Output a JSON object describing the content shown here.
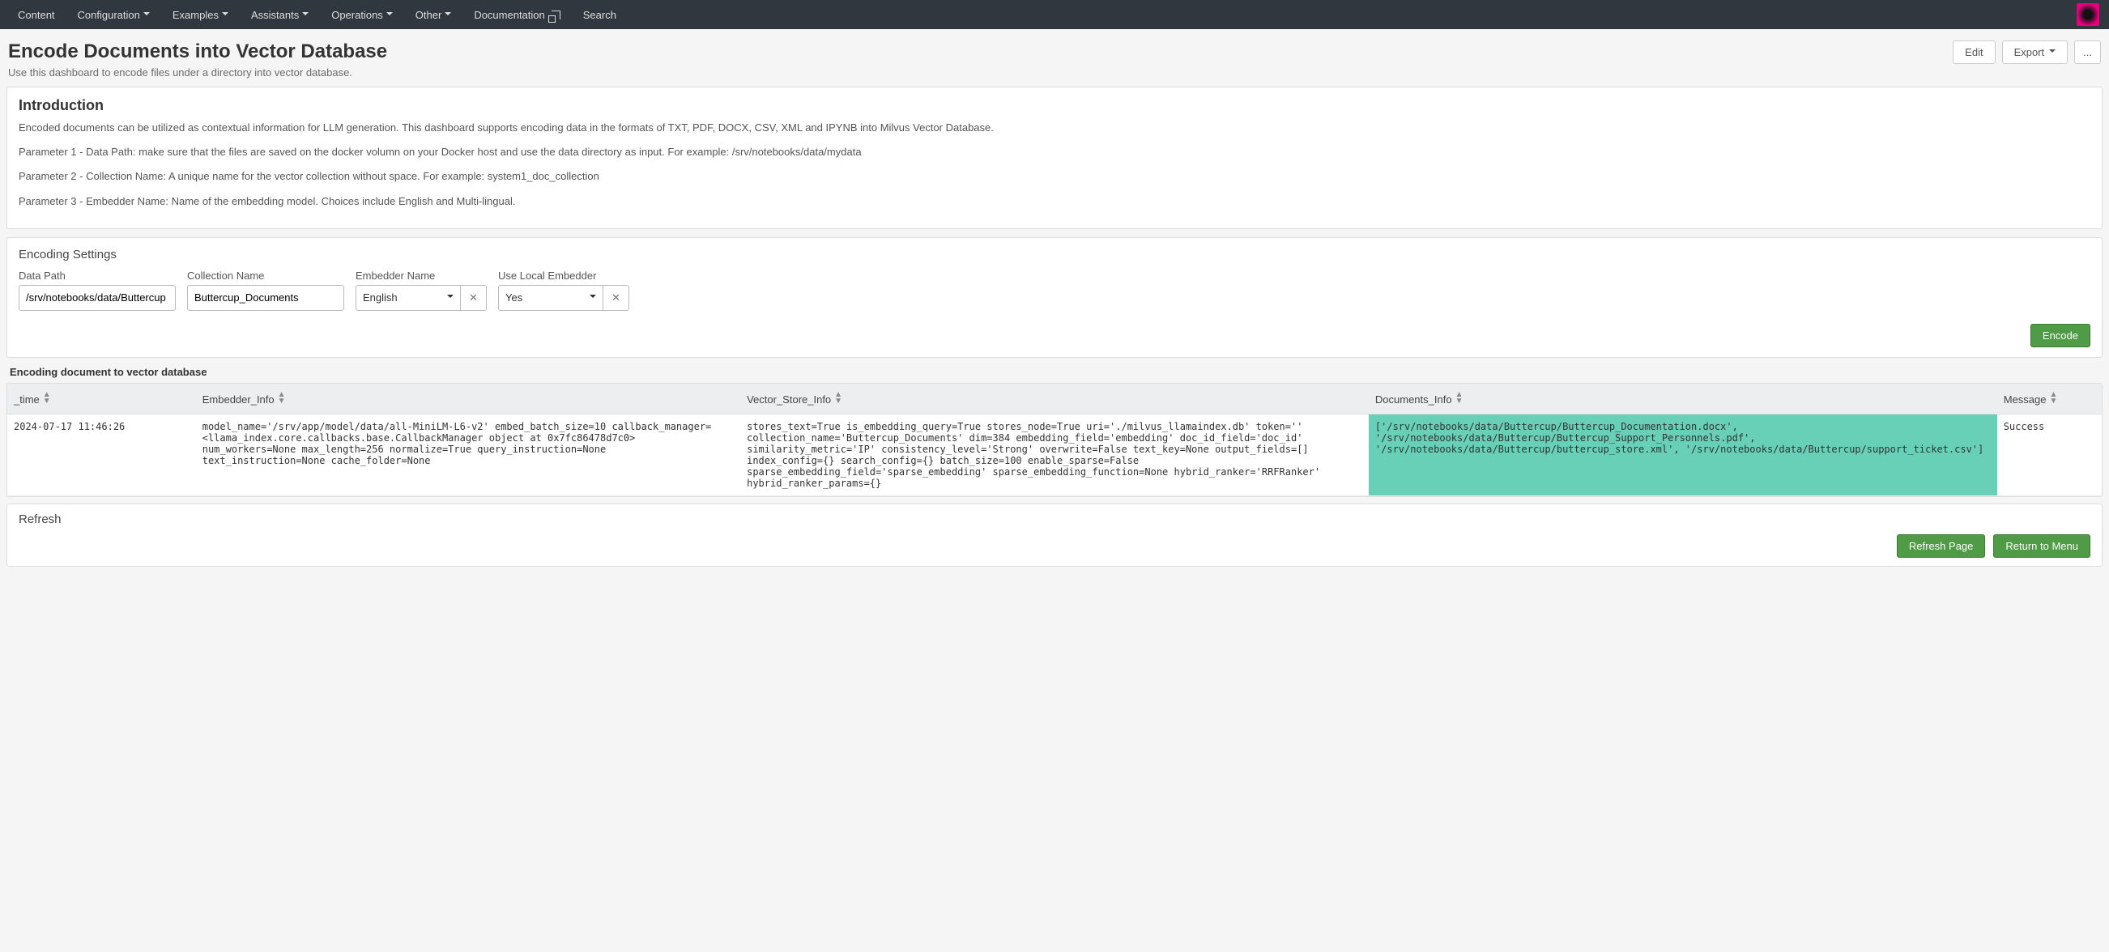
{
  "nav": {
    "items": [
      {
        "label": "Content",
        "caret": false
      },
      {
        "label": "Configuration",
        "caret": true
      },
      {
        "label": "Examples",
        "caret": true
      },
      {
        "label": "Assistants",
        "caret": true
      },
      {
        "label": "Operations",
        "caret": true
      },
      {
        "label": "Other",
        "caret": true
      },
      {
        "label": "Documentation",
        "external": true
      },
      {
        "label": "Search",
        "caret": false
      }
    ]
  },
  "header": {
    "title": "Encode Documents into Vector Database",
    "subtitle": "Use this dashboard to encode files under a directory into vector database.",
    "edit": "Edit",
    "export": "Export",
    "more": "..."
  },
  "intro": {
    "heading": "Introduction",
    "lines": [
      "Encoded documents can be utilized as contextual information for LLM generation. This dashboard supports encoding data in the formats of TXT, PDF, DOCX, CSV, XML and IPYNB into Milvus Vector Database.",
      "Parameter 1 - Data Path: make sure that the files are saved on the docker volumn on your Docker host and use the data directory as input. For example: /srv/notebooks/data/mydata",
      "Parameter 2 - Collection Name: A unique name for the vector collection without space. For example: system1_doc_collection",
      "Parameter 3 - Embedder Name: Name of the embedding model. Choices include English and Multi-lingual."
    ]
  },
  "settings": {
    "heading": "Encoding Settings",
    "data_path_label": "Data Path",
    "data_path_value": "/srv/notebooks/data/Buttercup",
    "collection_label": "Collection Name",
    "collection_value": "Buttercup_Documents",
    "embedder_label": "Embedder Name",
    "embedder_value": "English",
    "local_label": "Use Local Embedder",
    "local_value": "Yes",
    "encode_btn": "Encode"
  },
  "results": {
    "title": "Encoding document to vector database",
    "columns": [
      "_time",
      "Embedder_Info",
      "Vector_Store_Info",
      "Documents_Info",
      "Message"
    ],
    "row": {
      "time": "2024-07-17 11:46:26",
      "embedder": "model_name='/srv/app/model/data/all-MiniLM-L6-v2' embed_batch_size=10 callback_manager=<llama_index.core.callbacks.base.CallbackManager object at 0x7fc86478d7c0> num_workers=None max_length=256 normalize=True query_instruction=None text_instruction=None cache_folder=None",
      "vector": "stores_text=True is_embedding_query=True stores_node=True uri='./milvus_llamaindex.db' token='' collection_name='Buttercup_Documents' dim=384 embedding_field='embedding' doc_id_field='doc_id' similarity_metric='IP' consistency_level='Strong' overwrite=False text_key=None output_fields=[] index_config={} search_config={} batch_size=100 enable_sparse=False sparse_embedding_field='sparse_embedding' sparse_embedding_function=None hybrid_ranker='RRFRanker' hybrid_ranker_params={}",
      "documents": "['/srv/notebooks/data/Buttercup/Buttercup_Documentation.docx', '/srv/notebooks/data/Buttercup/Buttercup_Support_Personnels.pdf', '/srv/notebooks/data/Buttercup/buttercup_store.xml', '/srv/notebooks/data/Buttercup/support_ticket.csv']",
      "message": "Success"
    }
  },
  "footer": {
    "heading": "Refresh",
    "refresh_btn": "Refresh Page",
    "return_btn": "Return to Menu"
  }
}
